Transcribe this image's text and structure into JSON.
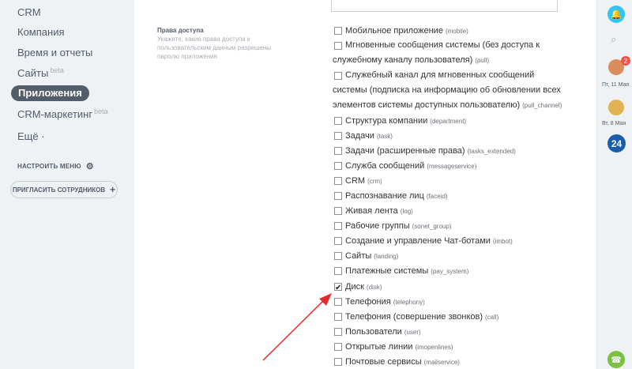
{
  "sidebar": {
    "items": [
      {
        "label": "CRM",
        "beta": ""
      },
      {
        "label": "Компания",
        "beta": ""
      },
      {
        "label": "Время и отчеты",
        "beta": ""
      },
      {
        "label": "Сайты",
        "beta": "beta"
      },
      {
        "label": "Приложения",
        "beta": ""
      },
      {
        "label": "CRM-маркетинг",
        "beta": "beta"
      },
      {
        "label": "Ещё ·",
        "beta": ""
      }
    ],
    "settings_menu": "НАСТРОИТЬ МЕНЮ",
    "invite_button": "ПРИГЛАСИТЬ СОТРУДНИКОВ"
  },
  "form": {
    "label": "Права доступа",
    "hint": "Укажите, какие права доступа к пользовательским данным разрешены паролю приложения",
    "permissions": [
      {
        "lines": [
          "Мобильное приложение"
        ],
        "code": "(mobile)",
        "checked": false
      },
      {
        "lines": [
          "Мгновенные сообщения системы (без доступа к",
          "служебному каналу пользователя)"
        ],
        "code": "(pull)",
        "checked": false
      },
      {
        "lines": [
          "Служебный канал для мгновенных сообщений",
          "системы (подписка на информацию об обновлении всех",
          "элементов системы доступных пользователю)"
        ],
        "code": "(pull_channel)",
        "checked": false
      },
      {
        "lines": [
          "Структура компании"
        ],
        "code": "(department)",
        "checked": false
      },
      {
        "lines": [
          "Задачи"
        ],
        "code": "(task)",
        "checked": false
      },
      {
        "lines": [
          "Задачи (расширенные права)"
        ],
        "code": "(tasks_extended)",
        "checked": false
      },
      {
        "lines": [
          "Служба сообщений"
        ],
        "code": "(messageservice)",
        "checked": false
      },
      {
        "lines": [
          "CRM"
        ],
        "code": "(crm)",
        "checked": false
      },
      {
        "lines": [
          "Распознавание лиц"
        ],
        "code": "(faceid)",
        "checked": false
      },
      {
        "lines": [
          "Живая лента"
        ],
        "code": "(log)",
        "checked": false
      },
      {
        "lines": [
          "Рабочие группы"
        ],
        "code": "(sonet_group)",
        "checked": false
      },
      {
        "lines": [
          "Создание и управление Чат-ботами"
        ],
        "code": "(imbot)",
        "checked": false
      },
      {
        "lines": [
          "Сайты"
        ],
        "code": "(landing)",
        "checked": false
      },
      {
        "lines": [
          "Платежные системы"
        ],
        "code": "(pay_system)",
        "checked": false
      },
      {
        "lines": [
          "Диск"
        ],
        "code": "(disk)",
        "checked": true
      },
      {
        "lines": [
          "Телефония"
        ],
        "code": "(telephony)",
        "checked": false
      },
      {
        "lines": [
          "Телефония (совершение звонков)"
        ],
        "code": "(call)",
        "checked": false
      },
      {
        "lines": [
          "Пользователи"
        ],
        "code": "(user)",
        "checked": false
      },
      {
        "lines": [
          "Открытые линии"
        ],
        "code": "(imopenlines)",
        "checked": false
      },
      {
        "lines": [
          "Почтовые сервисы"
        ],
        "code": "(mailservice)",
        "checked": false
      }
    ]
  },
  "rail": {
    "badge_count": "2",
    "date1": "Пт, 11 Мая",
    "date2": "Вт, 8 Мая",
    "logo_text": "24",
    "icons": [
      "bell-icon",
      "search-icon",
      "phone-icon"
    ]
  },
  "colors": {
    "accent": "#2fc6f6",
    "sidebar_bg": "#eef2f4",
    "active_item": "#535c69",
    "arrow": "#e52b2b",
    "badge": "#f0544e",
    "phone": "#7ac143"
  }
}
